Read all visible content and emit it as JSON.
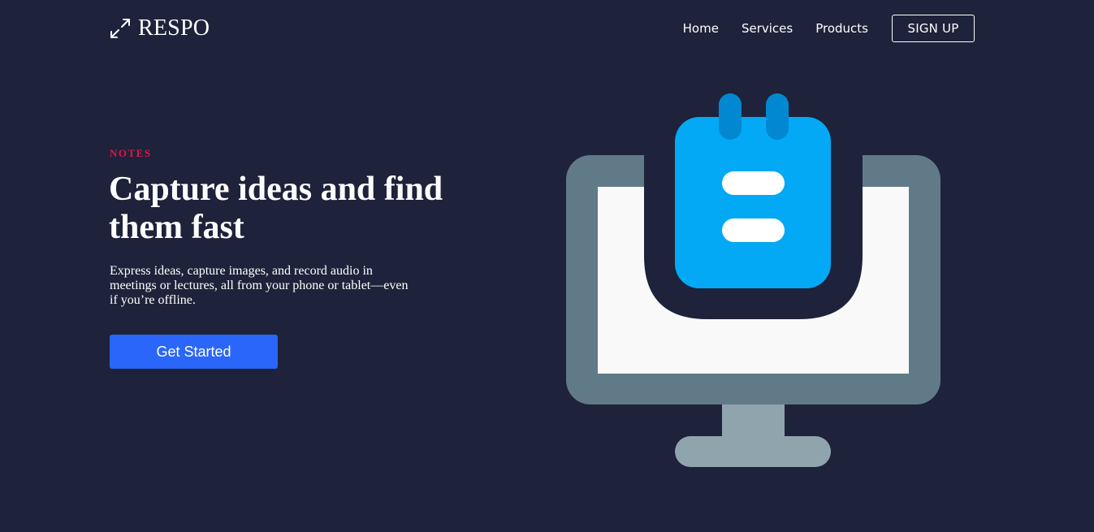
{
  "header": {
    "logo_text": "RESPO",
    "nav": {
      "home": "Home",
      "services": "Services",
      "products": "Products"
    },
    "signup_label": "SIGN UP"
  },
  "hero": {
    "eyebrow": "NOTES",
    "headline": "Capture ideas and find them fast",
    "description": "Express ideas, capture images, and record audio in meetings or lectures, all from your phone or tablet—even if you’re offline.",
    "cta_label": "Get Started"
  },
  "icons": {
    "logo": "expand-arrows-icon",
    "illustration": "monitor-with-notepad-icon"
  },
  "colors": {
    "background": "#1e223a",
    "accent_red": "#e0154a",
    "button_blue": "#2a66fa",
    "monitor_frame": "#607a88",
    "monitor_screen": "#f9f9f9",
    "notepad_blue": "#03a9f4",
    "notepad_ring": "#0288d1",
    "stand": "#90a4ae"
  }
}
